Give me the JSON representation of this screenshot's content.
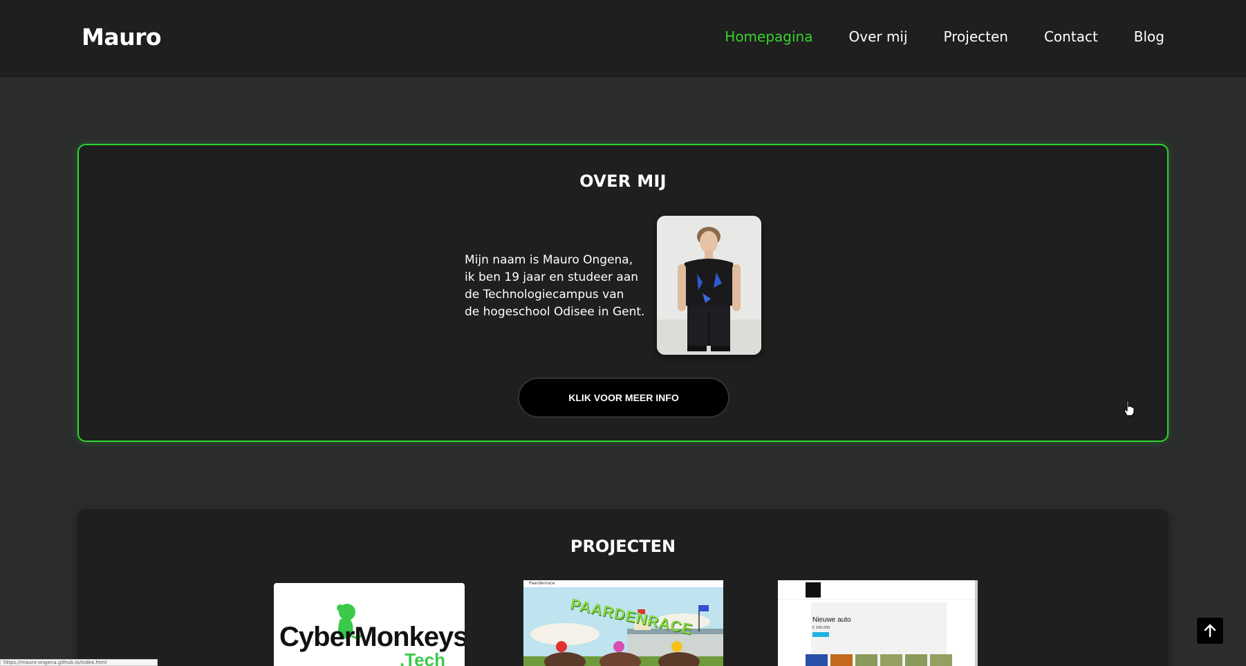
{
  "header": {
    "brand": "Mauro",
    "nav": [
      {
        "label": "Homepagina",
        "active": true
      },
      {
        "label": "Over mij",
        "active": false
      },
      {
        "label": "Projecten",
        "active": false
      },
      {
        "label": "Contact",
        "active": false
      },
      {
        "label": "Blog",
        "active": false
      }
    ]
  },
  "about": {
    "title": "OVER MIJ",
    "text_lines": [
      "Mijn naam is Mauro Ongena,",
      "ik ben 19 jaar en studeer aan",
      "de Technologiecampus van",
      "de hogeschool Odisee in Gent."
    ],
    "button_label": "KLIK VOOR MEER INFO"
  },
  "projects": {
    "title": "PROJECTEN",
    "cards": [
      {
        "title": "CyberMonkeys",
        "subtitle": ".Tech"
      },
      {
        "title": "PAARDENRACE",
        "window_title": "Paardenrace"
      },
      {
        "product_name": "Nieuwe auto",
        "price": "€ 100.000"
      }
    ]
  },
  "status_bar": {
    "url": "https://mauro-ongena.github.io/index.html"
  },
  "colors": {
    "accent": "#39d32a",
    "header_bg": "#1f1f1f",
    "page_bg": "#2b2d2d",
    "card_bg": "#1f1f1f"
  }
}
